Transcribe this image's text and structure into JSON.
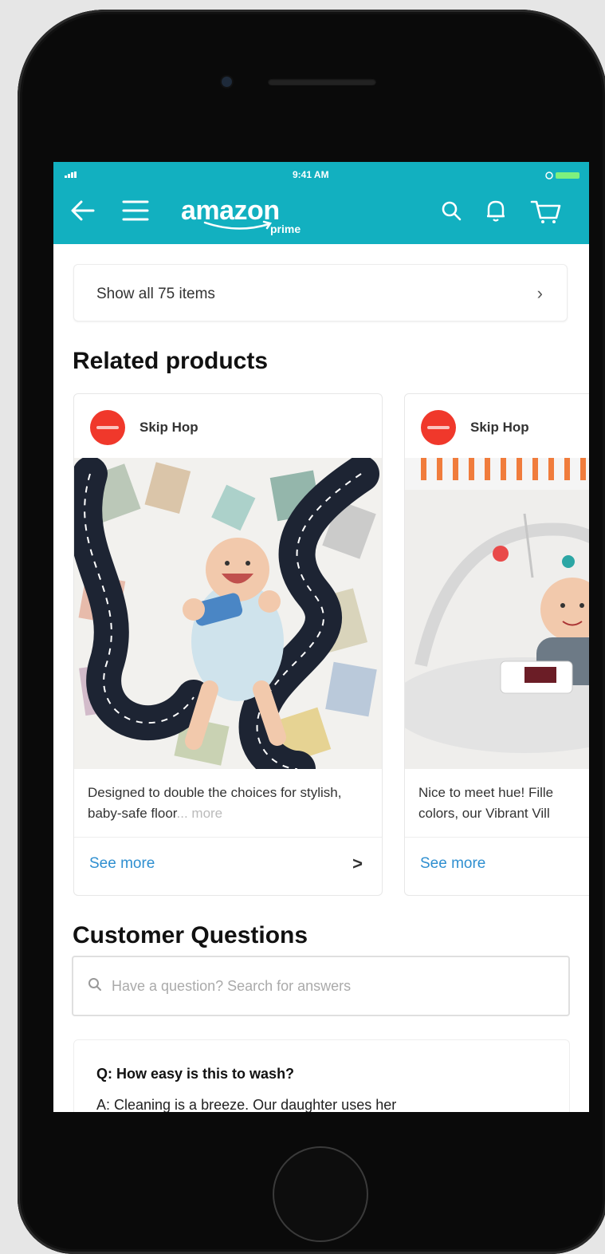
{
  "status_bar": {
    "time": "9:41 AM"
  },
  "header": {
    "logo_word": "amazon",
    "logo_sub": "prime",
    "back_icon": "arrow-left-icon",
    "menu_icon": "hamburger-icon",
    "search_icon": "search-icon",
    "notifications_icon": "bell-icon",
    "cart_icon": "cart-icon"
  },
  "show_all": {
    "label": "Show all 75 items",
    "chevron": "›"
  },
  "related": {
    "title": "Related products",
    "products": [
      {
        "brand": "Skip Hop",
        "description": "Designed to double the choices for stylish, baby-safe floor",
        "more_label": "... more",
        "see_more": "See more",
        "chevron": ">"
      },
      {
        "brand": "Skip Hop",
        "description": "Nice to meet hue! Fille colors, our Vibrant Vill",
        "see_more": "See more"
      }
    ]
  },
  "questions": {
    "title": "Customer Questions",
    "search_placeholder": "Have a question? Search for answers",
    "items": [
      {
        "question": "Q: How easy is this to wash?",
        "answer": "A: Cleaning is a breeze. Our daughter uses her"
      }
    ]
  },
  "colors": {
    "header_bg": "#12b0c0",
    "link": "#2f8fd0",
    "brand_logo": "#f0382b"
  }
}
